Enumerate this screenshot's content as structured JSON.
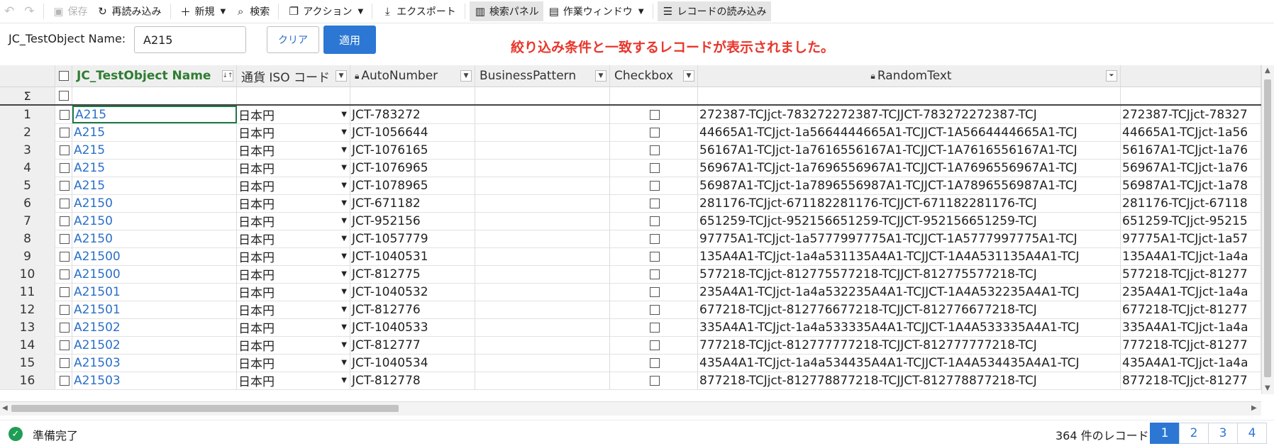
{
  "toolbar": {
    "save": "保存",
    "reload": "再読み込み",
    "new": "新規",
    "search": "検索",
    "action": "アクション",
    "export": "エクスポート",
    "search_panel": "検索パネル",
    "work_window": "作業ウィンドウ",
    "load_records": "レコードの読み込み"
  },
  "filter": {
    "label": "JC_TestObject Name:",
    "value": "A215",
    "clear": "クリア",
    "apply": "適用"
  },
  "notice": "絞り込み条件と一致するレコードが表示されました。",
  "grid": {
    "columns": {
      "name": "JC_TestObject Name",
      "currency": "通貨 ISO コード",
      "autonumber": "AutoNumber",
      "business": "BusinessPattern",
      "checkbox": "Checkbox",
      "random": "RandomText"
    },
    "sigma": "Σ",
    "rows": [
      {
        "n": "1",
        "name": "A215",
        "cur": "日本円",
        "auto": "JCT-783272",
        "rand": "272387-TCJjct-783272272387-TCJJCT-783272272387-TCJ",
        "rand2": "272387-TCJjct-78327"
      },
      {
        "n": "2",
        "name": "A215",
        "cur": "日本円",
        "auto": "JCT-1056644",
        "rand": "44665A1-TCJjct-1a5664444665A1-TCJJCT-1A5664444665A1-TCJ",
        "rand2": "44665A1-TCJjct-1a56"
      },
      {
        "n": "3",
        "name": "A215",
        "cur": "日本円",
        "auto": "JCT-1076165",
        "rand": "56167A1-TCJjct-1a7616556167A1-TCJJCT-1A7616556167A1-TCJ",
        "rand2": "56167A1-TCJjct-1a76"
      },
      {
        "n": "4",
        "name": "A215",
        "cur": "日本円",
        "auto": "JCT-1076965",
        "rand": "56967A1-TCJjct-1a7696556967A1-TCJJCT-1A7696556967A1-TCJ",
        "rand2": "56967A1-TCJjct-1a76"
      },
      {
        "n": "5",
        "name": "A215",
        "cur": "日本円",
        "auto": "JCT-1078965",
        "rand": "56987A1-TCJjct-1a7896556987A1-TCJJCT-1A7896556987A1-TCJ",
        "rand2": "56987A1-TCJjct-1a78"
      },
      {
        "n": "6",
        "name": "A2150",
        "cur": "日本円",
        "auto": "JCT-671182",
        "rand": "281176-TCJjct-671182281176-TCJJCT-671182281176-TCJ",
        "rand2": "281176-TCJjct-67118"
      },
      {
        "n": "7",
        "name": "A2150",
        "cur": "日本円",
        "auto": "JCT-952156",
        "rand": "651259-TCJjct-952156651259-TCJJCT-952156651259-TCJ",
        "rand2": "651259-TCJjct-95215"
      },
      {
        "n": "8",
        "name": "A2150",
        "cur": "日本円",
        "auto": "JCT-1057779",
        "rand": "97775A1-TCJjct-1a5777997775A1-TCJJCT-1A5777997775A1-TCJ",
        "rand2": "97775A1-TCJjct-1a57"
      },
      {
        "n": "9",
        "name": "A21500",
        "cur": "日本円",
        "auto": "JCT-1040531",
        "rand": "135A4A1-TCJjct-1a4a531135A4A1-TCJJCT-1A4A531135A4A1-TCJ",
        "rand2": "135A4A1-TCJjct-1a4a"
      },
      {
        "n": "10",
        "name": "A21500",
        "cur": "日本円",
        "auto": "JCT-812775",
        "rand": "577218-TCJjct-812775577218-TCJJCT-812775577218-TCJ",
        "rand2": "577218-TCJjct-81277"
      },
      {
        "n": "11",
        "name": "A21501",
        "cur": "日本円",
        "auto": "JCT-1040532",
        "rand": "235A4A1-TCJjct-1a4a532235A4A1-TCJJCT-1A4A532235A4A1-TCJ",
        "rand2": "235A4A1-TCJjct-1a4a"
      },
      {
        "n": "12",
        "name": "A21501",
        "cur": "日本円",
        "auto": "JCT-812776",
        "rand": "677218-TCJjct-812776677218-TCJJCT-812776677218-TCJ",
        "rand2": "677218-TCJjct-81277"
      },
      {
        "n": "13",
        "name": "A21502",
        "cur": "日本円",
        "auto": "JCT-1040533",
        "rand": "335A4A1-TCJjct-1a4a533335A4A1-TCJJCT-1A4A533335A4A1-TCJ",
        "rand2": "335A4A1-TCJjct-1a4a"
      },
      {
        "n": "14",
        "name": "A21502",
        "cur": "日本円",
        "auto": "JCT-812777",
        "rand": "777218-TCJjct-812777777218-TCJJCT-812777777218-TCJ",
        "rand2": "777218-TCJjct-81277"
      },
      {
        "n": "15",
        "name": "A21503",
        "cur": "日本円",
        "auto": "JCT-1040534",
        "rand": "435A4A1-TCJjct-1a4a534435A4A1-TCJJCT-1A4A534435A4A1-TCJ",
        "rand2": "435A4A1-TCJjct-1a4a"
      },
      {
        "n": "16",
        "name": "A21503",
        "cur": "日本円",
        "auto": "JCT-812778",
        "rand": "877218-TCJjct-812778877218-TCJJCT-812778877218-TCJ",
        "rand2": "877218-TCJjct-81277"
      }
    ]
  },
  "status": {
    "ready": "準備完了",
    "count": "364 件のレコード",
    "pages": [
      "1",
      "2",
      "3",
      "4"
    ]
  }
}
